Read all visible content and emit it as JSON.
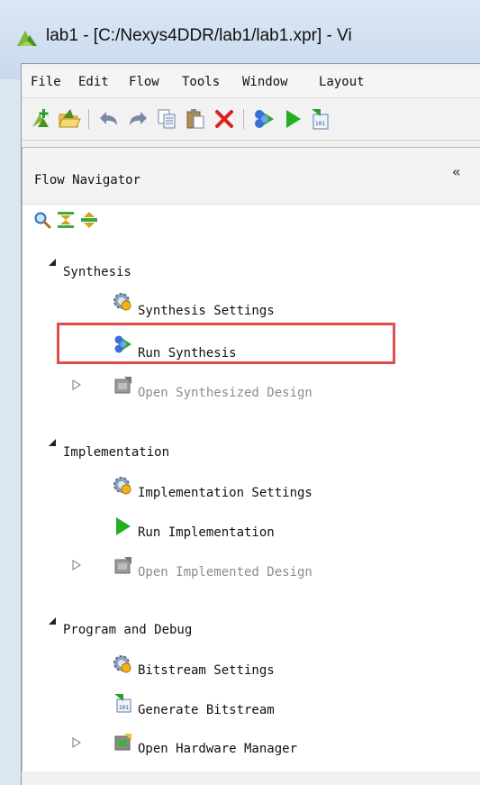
{
  "window": {
    "title": "lab1 - [C:/Nexys4DDR/lab1/lab1.xpr] - Vi",
    "icon": "vivado-logo-icon"
  },
  "menubar": {
    "items": [
      "File",
      "Edit",
      "Flow",
      "Tools",
      "Window",
      "Layout"
    ]
  },
  "toolbar": {
    "buttons": [
      "new-project-icon",
      "open-project-icon",
      "undo-icon",
      "redo-icon",
      "copy-icon",
      "paste-icon",
      "delete-icon",
      "run-synthesis-icon",
      "run-implementation-icon",
      "generate-bitstream-icon"
    ]
  },
  "flow_navigator": {
    "title": "Flow Navigator",
    "collapse_glyph": "«",
    "tools": [
      "search-icon",
      "collapse-all-icon",
      "expand-all-icon"
    ],
    "sections": [
      {
        "label": "Synthesis",
        "items": [
          {
            "label": "Synthesis Settings",
            "icon": "gear-icon",
            "enabled": true
          },
          {
            "label": "Run Synthesis",
            "icon": "run-synthesis-icon",
            "enabled": true,
            "highlighted": true
          },
          {
            "label": "Open Synthesized Design",
            "icon": "open-design-icon",
            "enabled": false
          }
        ]
      },
      {
        "label": "Implementation",
        "items": [
          {
            "label": "Implementation Settings",
            "icon": "gear-icon",
            "enabled": true
          },
          {
            "label": "Run Implementation",
            "icon": "play-icon",
            "enabled": true
          },
          {
            "label": "Open Implemented Design",
            "icon": "open-design-icon",
            "enabled": false
          }
        ]
      },
      {
        "label": "Program and Debug",
        "items": [
          {
            "label": "Bitstream Settings",
            "icon": "gear-icon",
            "enabled": true
          },
          {
            "label": "Generate Bitstream",
            "icon": "bitstream-icon",
            "enabled": true
          },
          {
            "label": "Open Hardware Manager",
            "icon": "hardware-manager-icon",
            "enabled": true
          }
        ]
      }
    ]
  },
  "colors": {
    "highlight_border": "#e04b4b",
    "disabled_text": "#8c8c8c",
    "play_green": "#22b022"
  }
}
